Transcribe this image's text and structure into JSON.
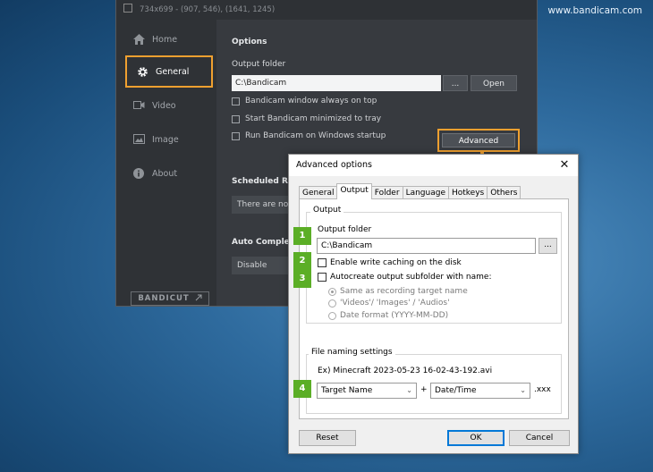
{
  "watermark": "www.bandicam.com",
  "bandicam": {
    "title": "734x699 - (907, 546), (1641, 1245)",
    "nav": [
      {
        "label": "Home",
        "icon": "home-icon"
      },
      {
        "label": "General",
        "icon": "gear-icon",
        "active": true
      },
      {
        "label": "Video",
        "icon": "video-icon"
      },
      {
        "label": "Image",
        "icon": "image-icon"
      },
      {
        "label": "About",
        "icon": "info-icon"
      }
    ],
    "bandicut_label": "BANDICUT",
    "options_heading": "Options",
    "output_folder_label": "Output folder",
    "output_folder_value": "C:\\Bandicam",
    "browse_label": "...",
    "open_label": "Open",
    "checks": [
      "Bandicam window always on top",
      "Start Bandicam minimized to tray",
      "Run Bandicam on Windows startup"
    ],
    "advanced_label": "Advanced",
    "scheduled_heading": "Scheduled Rec",
    "scheduled_value": "There are no sc",
    "auto_complete_heading": "Auto Complete",
    "auto_complete_value": "Disable"
  },
  "dialog": {
    "title": "Advanced options",
    "close_glyph": "✕",
    "tabs": [
      "General",
      "Output",
      "Folder",
      "Language",
      "Hotkeys",
      "Others"
    ],
    "active_tab": "Output",
    "output_group_title": "Output",
    "output_folder_label": "Output folder",
    "output_folder_value": "C:\\Bandicam",
    "browse_label": "...",
    "write_caching_label": "Enable write caching on the disk",
    "autocreate_label": "Autocreate output subfolder with name:",
    "radio_options": [
      "Same as recording target name",
      "'Videos'/ 'Images' / 'Audios'",
      "Date format (YYYY-MM-DD)"
    ],
    "file_naming_title": "File naming settings",
    "example_text": "Ex) Minecraft 2023-05-23 16-02-43-192.avi",
    "name_select_value": "Target Name",
    "plus_sign": "+",
    "date_select_value": "Date/Time",
    "extension_text": ".xxx",
    "reset_label": "Reset",
    "ok_label": "OK",
    "cancel_label": "Cancel"
  },
  "badges": [
    "1",
    "2",
    "3",
    "4"
  ],
  "colors": {
    "highlight": "#f0a030",
    "badge": "#5bae26",
    "default_button_border": "#0078d7"
  }
}
